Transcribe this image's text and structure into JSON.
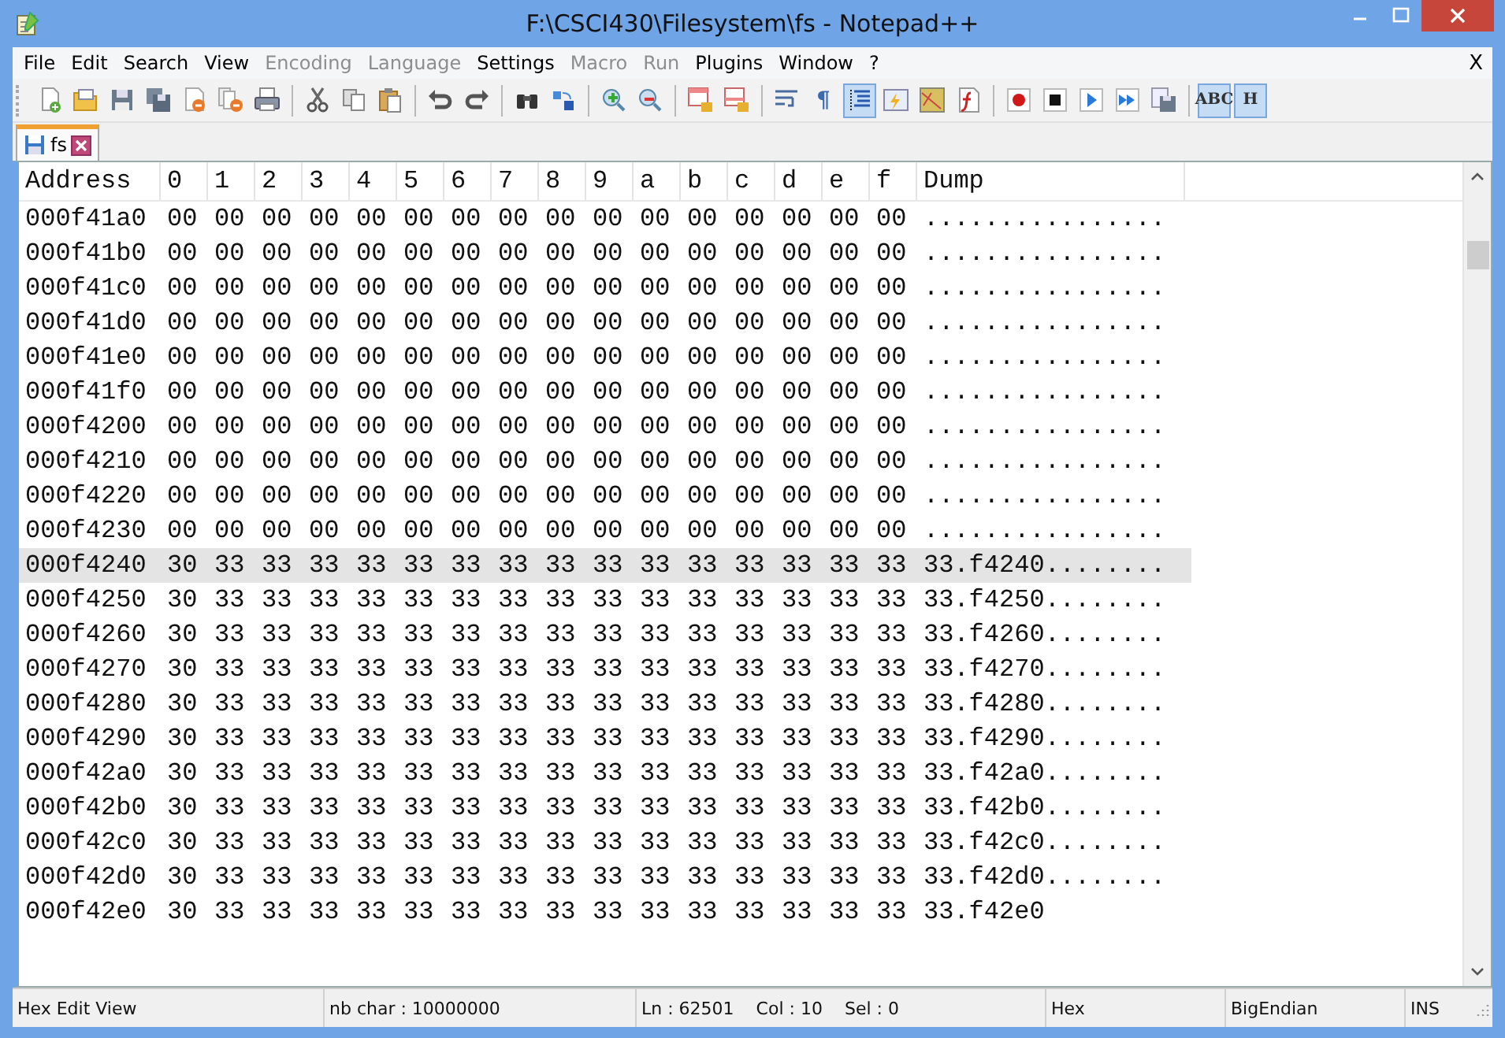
{
  "window": {
    "title": "F:\\CSCI430\\Filesystem\\fs - Notepad++"
  },
  "menu": [
    {
      "label": "File",
      "disabled": false
    },
    {
      "label": "Edit",
      "disabled": false
    },
    {
      "label": "Search",
      "disabled": false
    },
    {
      "label": "View",
      "disabled": false
    },
    {
      "label": "Encoding",
      "disabled": true
    },
    {
      "label": "Language",
      "disabled": true
    },
    {
      "label": "Settings",
      "disabled": false
    },
    {
      "label": "Macro",
      "disabled": true
    },
    {
      "label": "Run",
      "disabled": true
    },
    {
      "label": "Plugins",
      "disabled": false
    },
    {
      "label": "Window",
      "disabled": false
    },
    {
      "label": "?",
      "disabled": false
    }
  ],
  "menu_close": "X",
  "toolbar": [
    {
      "kind": "button",
      "on": false
    },
    {
      "kind": "button",
      "on": false
    },
    {
      "kind": "button",
      "on": false
    },
    {
      "kind": "button",
      "on": false
    },
    {
      "kind": "button",
      "on": false
    },
    {
      "kind": "button",
      "on": false
    },
    {
      "kind": "button",
      "on": false
    },
    {
      "kind": "separator"
    },
    {
      "kind": "button",
      "on": false
    },
    {
      "kind": "button",
      "on": false
    },
    {
      "kind": "button",
      "on": false
    },
    {
      "kind": "separator"
    },
    {
      "kind": "button",
      "on": false
    },
    {
      "kind": "button",
      "on": false
    },
    {
      "kind": "separator"
    },
    {
      "kind": "button",
      "on": false
    },
    {
      "kind": "button",
      "on": false
    },
    {
      "kind": "separator"
    },
    {
      "kind": "button",
      "on": false
    },
    {
      "kind": "button",
      "on": false
    },
    {
      "kind": "separator"
    },
    {
      "kind": "button",
      "on": false
    },
    {
      "kind": "button",
      "on": false
    },
    {
      "kind": "separator"
    },
    {
      "kind": "button",
      "on": false
    },
    {
      "kind": "text",
      "label": "¶",
      "on": false
    },
    {
      "kind": "button",
      "on": true
    },
    {
      "kind": "button",
      "on": false
    },
    {
      "kind": "button",
      "on": false
    },
    {
      "kind": "button",
      "on": false
    },
    {
      "kind": "separator"
    },
    {
      "kind": "button",
      "on": false
    },
    {
      "kind": "button",
      "on": false
    },
    {
      "kind": "button",
      "on": false
    },
    {
      "kind": "button",
      "on": false
    },
    {
      "kind": "button",
      "on": false
    },
    {
      "kind": "separator"
    },
    {
      "kind": "text",
      "label": "ABC",
      "on": true
    },
    {
      "kind": "text",
      "label": "H",
      "on": true
    }
  ],
  "tabs": [
    {
      "label": "fs",
      "selected": true
    }
  ],
  "table": {
    "columns": [
      "Address",
      "0",
      "1",
      "2",
      "3",
      "4",
      "5",
      "6",
      "7",
      "8",
      "9",
      "a",
      "b",
      "c",
      "d",
      "e",
      "f",
      "Dump"
    ],
    "rows": [
      {
        "address": "000f41a0",
        "bytes": [
          "00",
          "00",
          "00",
          "00",
          "00",
          "00",
          "00",
          "00",
          "00",
          "00",
          "00",
          "00",
          "00",
          "00",
          "00",
          "00"
        ],
        "dump": "................",
        "selected": false
      },
      {
        "address": "000f41b0",
        "bytes": [
          "00",
          "00",
          "00",
          "00",
          "00",
          "00",
          "00",
          "00",
          "00",
          "00",
          "00",
          "00",
          "00",
          "00",
          "00",
          "00"
        ],
        "dump": "................",
        "selected": false
      },
      {
        "address": "000f41c0",
        "bytes": [
          "00",
          "00",
          "00",
          "00",
          "00",
          "00",
          "00",
          "00",
          "00",
          "00",
          "00",
          "00",
          "00",
          "00",
          "00",
          "00"
        ],
        "dump": "................",
        "selected": false
      },
      {
        "address": "000f41d0",
        "bytes": [
          "00",
          "00",
          "00",
          "00",
          "00",
          "00",
          "00",
          "00",
          "00",
          "00",
          "00",
          "00",
          "00",
          "00",
          "00",
          "00"
        ],
        "dump": "................",
        "selected": false
      },
      {
        "address": "000f41e0",
        "bytes": [
          "00",
          "00",
          "00",
          "00",
          "00",
          "00",
          "00",
          "00",
          "00",
          "00",
          "00",
          "00",
          "00",
          "00",
          "00",
          "00"
        ],
        "dump": "................",
        "selected": false
      },
      {
        "address": "000f41f0",
        "bytes": [
          "00",
          "00",
          "00",
          "00",
          "00",
          "00",
          "00",
          "00",
          "00",
          "00",
          "00",
          "00",
          "00",
          "00",
          "00",
          "00"
        ],
        "dump": "................",
        "selected": false
      },
      {
        "address": "000f4200",
        "bytes": [
          "00",
          "00",
          "00",
          "00",
          "00",
          "00",
          "00",
          "00",
          "00",
          "00",
          "00",
          "00",
          "00",
          "00",
          "00",
          "00"
        ],
        "dump": "................",
        "selected": false
      },
      {
        "address": "000f4210",
        "bytes": [
          "00",
          "00",
          "00",
          "00",
          "00",
          "00",
          "00",
          "00",
          "00",
          "00",
          "00",
          "00",
          "00",
          "00",
          "00",
          "00"
        ],
        "dump": "................",
        "selected": false
      },
      {
        "address": "000f4220",
        "bytes": [
          "00",
          "00",
          "00",
          "00",
          "00",
          "00",
          "00",
          "00",
          "00",
          "00",
          "00",
          "00",
          "00",
          "00",
          "00",
          "00"
        ],
        "dump": "................",
        "selected": false
      },
      {
        "address": "000f4230",
        "bytes": [
          "00",
          "00",
          "00",
          "00",
          "00",
          "00",
          "00",
          "00",
          "00",
          "00",
          "00",
          "00",
          "00",
          "00",
          "00",
          "00"
        ],
        "dump": "................",
        "selected": false
      },
      {
        "address": "000f4240",
        "bytes": [
          "30",
          "33",
          "33",
          "33",
          "33",
          "33",
          "33",
          "33",
          "33",
          "33",
          "33",
          "33",
          "33",
          "33",
          "33",
          "33"
        ],
        "dump": "33.f4240........",
        "selected": true
      },
      {
        "address": "000f4250",
        "bytes": [
          "30",
          "33",
          "33",
          "33",
          "33",
          "33",
          "33",
          "33",
          "33",
          "33",
          "33",
          "33",
          "33",
          "33",
          "33",
          "33"
        ],
        "dump": "33.f4250........",
        "selected": false
      },
      {
        "address": "000f4260",
        "bytes": [
          "30",
          "33",
          "33",
          "33",
          "33",
          "33",
          "33",
          "33",
          "33",
          "33",
          "33",
          "33",
          "33",
          "33",
          "33",
          "33"
        ],
        "dump": "33.f4260........",
        "selected": false
      },
      {
        "address": "000f4270",
        "bytes": [
          "30",
          "33",
          "33",
          "33",
          "33",
          "33",
          "33",
          "33",
          "33",
          "33",
          "33",
          "33",
          "33",
          "33",
          "33",
          "33"
        ],
        "dump": "33.f4270........",
        "selected": false
      },
      {
        "address": "000f4280",
        "bytes": [
          "30",
          "33",
          "33",
          "33",
          "33",
          "33",
          "33",
          "33",
          "33",
          "33",
          "33",
          "33",
          "33",
          "33",
          "33",
          "33"
        ],
        "dump": "33.f4280........",
        "selected": false
      },
      {
        "address": "000f4290",
        "bytes": [
          "30",
          "33",
          "33",
          "33",
          "33",
          "33",
          "33",
          "33",
          "33",
          "33",
          "33",
          "33",
          "33",
          "33",
          "33",
          "33"
        ],
        "dump": "33.f4290........",
        "selected": false
      },
      {
        "address": "000f42a0",
        "bytes": [
          "30",
          "33",
          "33",
          "33",
          "33",
          "33",
          "33",
          "33",
          "33",
          "33",
          "33",
          "33",
          "33",
          "33",
          "33",
          "33"
        ],
        "dump": "33.f42a0........",
        "selected": false
      },
      {
        "address": "000f42b0",
        "bytes": [
          "30",
          "33",
          "33",
          "33",
          "33",
          "33",
          "33",
          "33",
          "33",
          "33",
          "33",
          "33",
          "33",
          "33",
          "33",
          "33"
        ],
        "dump": "33.f42b0........",
        "selected": false
      },
      {
        "address": "000f42c0",
        "bytes": [
          "30",
          "33",
          "33",
          "33",
          "33",
          "33",
          "33",
          "33",
          "33",
          "33",
          "33",
          "33",
          "33",
          "33",
          "33",
          "33"
        ],
        "dump": "33.f42c0........",
        "selected": false
      },
      {
        "address": "000f42d0",
        "bytes": [
          "30",
          "33",
          "33",
          "33",
          "33",
          "33",
          "33",
          "33",
          "33",
          "33",
          "33",
          "33",
          "33",
          "33",
          "33",
          "33"
        ],
        "dump": "33.f42d0........",
        "selected": false
      },
      {
        "address": "000f42e0",
        "bytes": [
          "30",
          "33",
          "33",
          "33",
          "33",
          "33",
          "33",
          "33",
          "33",
          "33",
          "33",
          "33",
          "33",
          "33",
          "33",
          "33"
        ],
        "dump": "33.f42e0",
        "selected": false
      }
    ]
  },
  "status_bar": {
    "view": "Hex Edit View",
    "length": "nb char : 10000000",
    "line": "Ln : 62501",
    "column": "Col : 10",
    "selection": "Sel : 0",
    "mode": "Hex",
    "endian": "BigEndian",
    "insert": "INS"
  }
}
